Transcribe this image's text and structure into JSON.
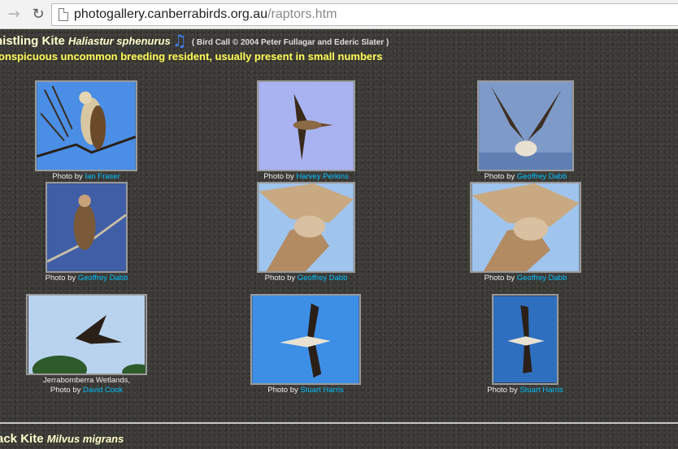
{
  "browser": {
    "url_host": "photogallery.canberrabirds.org.au",
    "url_path": "/raptors.htm",
    "back_icon": "arrow-right-icon",
    "reload_icon": "reload-icon"
  },
  "species": [
    {
      "common_name": "histling Kite",
      "scientific_name": "Haliastur sphenurus",
      "call_credit": "( Bird Call © 2004 Peter Fullagar and Ederic Slater )",
      "status": "onspicuous uncommon breeding resident, usually present in small numbers",
      "photos": [
        {
          "location": "",
          "prefix": "Photo by",
          "photographer": "Ian Fraser"
        },
        {
          "location": "",
          "prefix": "Photo by",
          "photographer": "Harvey Perkins"
        },
        {
          "location": "",
          "prefix": "Photo by",
          "photographer": "Geoffrey Dabb"
        },
        {
          "location": "",
          "prefix": "Photo by",
          "photographer": "Geoffrey Dabb"
        },
        {
          "location": "",
          "prefix": "Photo by",
          "photographer": "Geoffrey Dabb"
        },
        {
          "location": "",
          "prefix": "Photo by",
          "photographer": "Geoffrey Dabb"
        },
        {
          "location": "Jerrabomberra Wetlands,",
          "prefix": "Photo by",
          "photographer": "David Cook"
        },
        {
          "location": "",
          "prefix": "Photo by",
          "photographer": "Stuart Harris"
        },
        {
          "location": "",
          "prefix": "Photo by",
          "photographer": "Stuart Harris"
        }
      ]
    },
    {
      "common_name": "ack Kite",
      "scientific_name": "Milvus migrans"
    }
  ]
}
